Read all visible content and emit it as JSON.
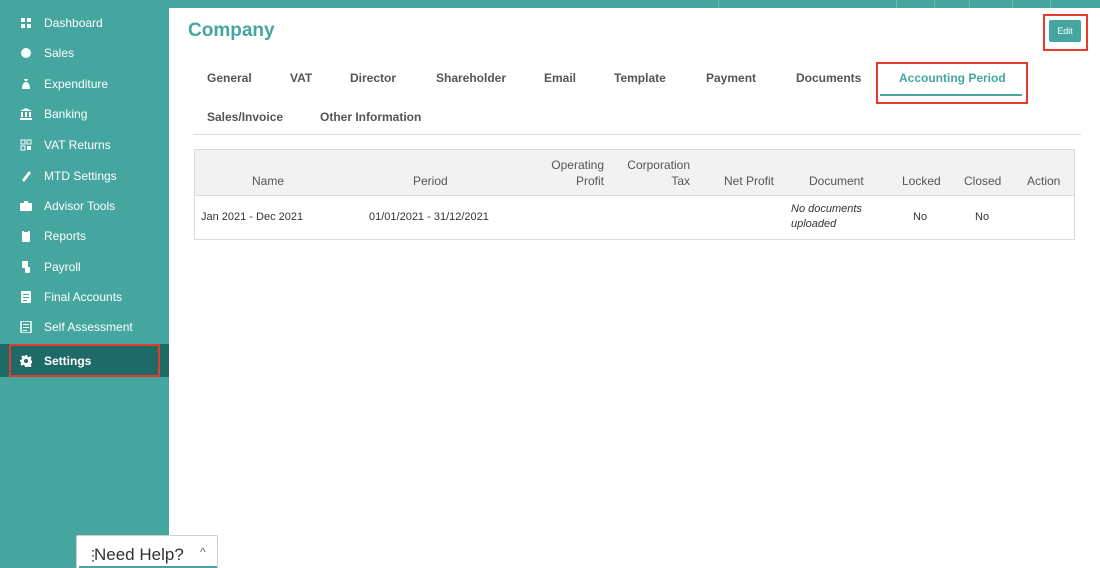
{
  "sidebar": {
    "items": [
      {
        "label": "Dashboard",
        "icon": "dashboard-icon"
      },
      {
        "label": "Sales",
        "icon": "sales-icon"
      },
      {
        "label": "Expenditure",
        "icon": "expenditure-icon"
      },
      {
        "label": "Banking",
        "icon": "bank-icon"
      },
      {
        "label": "VAT Returns",
        "icon": "vat-returns-icon"
      },
      {
        "label": "MTD Settings",
        "icon": "mtd-settings-icon"
      },
      {
        "label": "Advisor Tools",
        "icon": "briefcase-icon"
      },
      {
        "label": "Reports",
        "icon": "reports-icon"
      },
      {
        "label": "Payroll",
        "icon": "payroll-icon"
      },
      {
        "label": "Final Accounts",
        "icon": "final-accounts-icon"
      },
      {
        "label": "Self Assessment",
        "icon": "self-assessment-icon"
      },
      {
        "label": "Settings",
        "icon": "gear-icon",
        "active": true
      }
    ]
  },
  "header": {
    "title": "Company",
    "edit_label": "Edit"
  },
  "tabs": [
    {
      "label": "General"
    },
    {
      "label": "VAT"
    },
    {
      "label": "Director"
    },
    {
      "label": "Shareholder"
    },
    {
      "label": "Email"
    },
    {
      "label": "Template"
    },
    {
      "label": "Payment"
    },
    {
      "label": "Documents"
    },
    {
      "label": "Accounting Period",
      "active": true
    },
    {
      "label": "Sales/Invoice"
    },
    {
      "label": "Other Information"
    }
  ],
  "table": {
    "columns": {
      "name": "Name",
      "period": "Period",
      "operating_profit_1": "Operating",
      "operating_profit_2": "Profit",
      "corporation_tax_1": "Corporation",
      "corporation_tax_2": "Tax",
      "net_profit": "Net Profit",
      "document": "Document",
      "locked": "Locked",
      "closed": "Closed",
      "action": "Action"
    },
    "rows": [
      {
        "name": "Jan 2021 - Dec 2021",
        "period": "01/01/2021 - 31/12/2021",
        "operating_profit": "",
        "corporation_tax": "",
        "net_profit": "",
        "document_1": "No documents",
        "document_2": "uploaded",
        "locked": "No",
        "closed": "No",
        "action": ""
      }
    ]
  },
  "help_widget": {
    "label": "Need Help?",
    "dots": "⋮",
    "chevron": "^"
  },
  "colors": {
    "brand": "#45a6a0",
    "sidebar_active": "#1e6a67",
    "highlight": "#e53a2c"
  }
}
